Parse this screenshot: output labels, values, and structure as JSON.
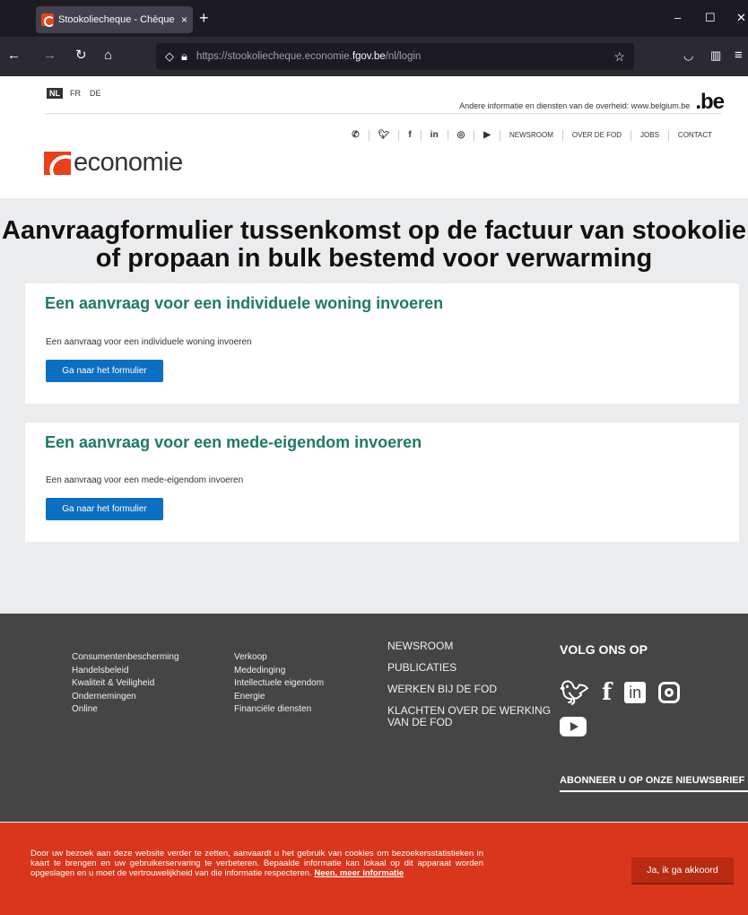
{
  "browser": {
    "tab_title": "Stookoliecheque - Chèque Mazout",
    "tab_close": "×",
    "new_tab": "+",
    "url_prefix": "https://stookoliecheque.economie.",
    "url_domain": "fgov.be",
    "url_path": "/nl/login",
    "win_min": "–",
    "win_max": "☐",
    "win_close": "✕"
  },
  "header": {
    "languages": [
      "NL",
      "FR",
      "DE"
    ],
    "belgium_text": "Andere informatie en diensten van de overheid: www.belgium.be",
    "belgium_logo": ".be",
    "topnav_icons": [
      "phone-icon",
      "twitter-icon",
      "facebook-icon",
      "linkedin-icon",
      "instagram-icon",
      "youtube-icon"
    ],
    "topnav_links": [
      "NEWSROOM",
      "OVER DE FOD",
      "JOBS",
      "CONTACT"
    ],
    "logo_text": "economie"
  },
  "main": {
    "title": "Aanvraagformulier tussenkomst op de factuur van stookolie of propaan in bulk bestemd voor verwarming",
    "cards": [
      {
        "heading": "Een aanvraag voor een individuele woning invoeren",
        "text": "Een aanvraag voor een individuele woning invoeren",
        "button": "Ga naar het formulier"
      },
      {
        "heading": "Een aanvraag voor een mede-eigendom invoeren",
        "text": "Een aanvraag voor een mede-eigendom invoeren",
        "button": "Ga naar het formulier"
      }
    ]
  },
  "footer": {
    "col1": [
      "Consumentenbescherming",
      "Handelsbeleid",
      "Kwaliteit & Veiligheid",
      "Ondernemingen",
      "Online"
    ],
    "col2": [
      "Verkoop",
      "Mededinging",
      "Intellectuele eigendom",
      "Energie",
      "Financiële diensten"
    ],
    "col3": [
      "NEWSROOM",
      "PUBLICATIES",
      "WERKEN BIJ DE FOD",
      "KLACHTEN OVER DE WERKING VAN DE FOD"
    ],
    "follow_title": "VOLG ONS OP",
    "social": [
      "twitter-icon",
      "facebook-icon",
      "linkedin-icon",
      "instagram-icon",
      "youtube-icon"
    ],
    "subscribe": "ABONNEER U OP ONZE NIEUWSBRIEF"
  },
  "cookie": {
    "text": "Door uw bezoek aan deze website verder te zetten, aanvaardt u het gebruik van cookies om bezoekersstatistieken in kaart te brengen en uw gebruikerservaring te verbeteren. Bepaalde informatie kan lokaal op dit apparaat worden opgeslagen en u moet de vertrouwelijkheid van die informatie respecteren.",
    "more_link": "Neen, meer informatie",
    "accept": "Ja, ik ga akkoord"
  },
  "colors": {
    "accent": "#1f7a64",
    "button": "#0d6fc2",
    "brand": "#e8421a",
    "cookie_bg": "#d9361b",
    "footer_bg": "#454545"
  }
}
